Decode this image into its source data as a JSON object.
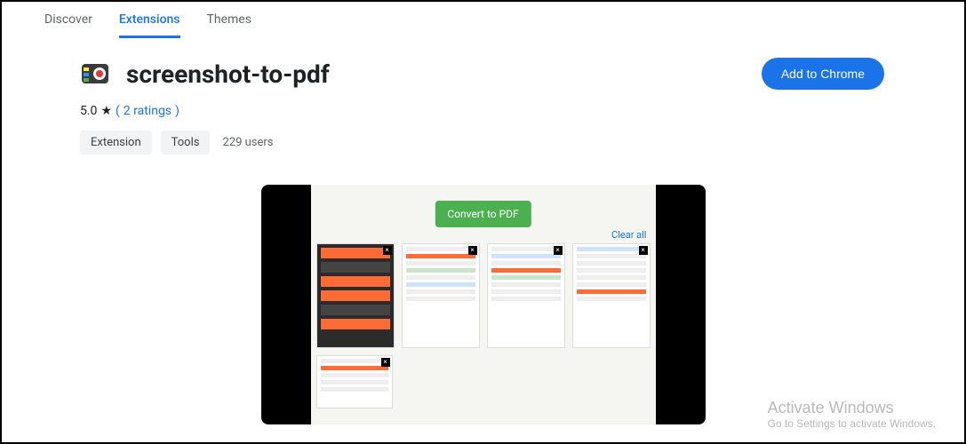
{
  "tabs": {
    "discover": "Discover",
    "extensions": "Extensions",
    "themes": "Themes"
  },
  "extension": {
    "name": "screenshot-to-pdf",
    "rating_value": "5.0",
    "ratings_text": "2 ratings",
    "users_text": "229 users"
  },
  "chips": {
    "extension": "Extension",
    "tools": "Tools"
  },
  "cta": {
    "label": "Add to Chrome"
  },
  "preview": {
    "convert_label": "Convert to PDF",
    "clear_label": "Clear all"
  },
  "watermark": {
    "title": "Activate Windows",
    "subtitle": "Go to Settings to activate Windows."
  }
}
